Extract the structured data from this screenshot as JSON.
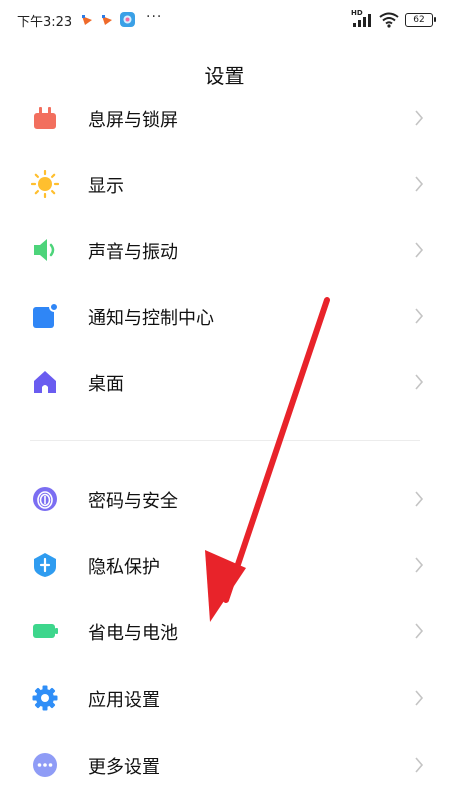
{
  "status_bar": {
    "time": "下午3:23",
    "more": "···",
    "network_badge": "HD",
    "battery": "62"
  },
  "page": {
    "title": "设置"
  },
  "items": [
    {
      "label": "息屏与锁屏",
      "icon": "lock-screen-icon"
    },
    {
      "label": "显示",
      "icon": "sun-icon"
    },
    {
      "label": "声音与振动",
      "icon": "speaker-icon"
    },
    {
      "label": "通知与控制中心",
      "icon": "notification-icon"
    },
    {
      "label": "桌面",
      "icon": "home-icon"
    },
    {
      "label": "密码与安全",
      "icon": "fingerprint-icon"
    },
    {
      "label": "隐私保护",
      "icon": "privacy-shield-icon"
    },
    {
      "label": "省电与电池",
      "icon": "battery-icon"
    },
    {
      "label": "应用设置",
      "icon": "gear-icon"
    },
    {
      "label": "更多设置",
      "icon": "more-dots-icon"
    }
  ],
  "colors": {
    "lock_screen": "#f26f5e",
    "display": "#ffbf2e",
    "sound": "#4dd47a",
    "notification": "#2f86f6",
    "home": "#6a5cf0",
    "security": "#7b6ef2",
    "privacy": "#2f9cf0",
    "battery": "#3dd68c",
    "apps": "#2f8ef7",
    "more": "#8f9cf6",
    "annotation_arrow": "#e8232a"
  }
}
